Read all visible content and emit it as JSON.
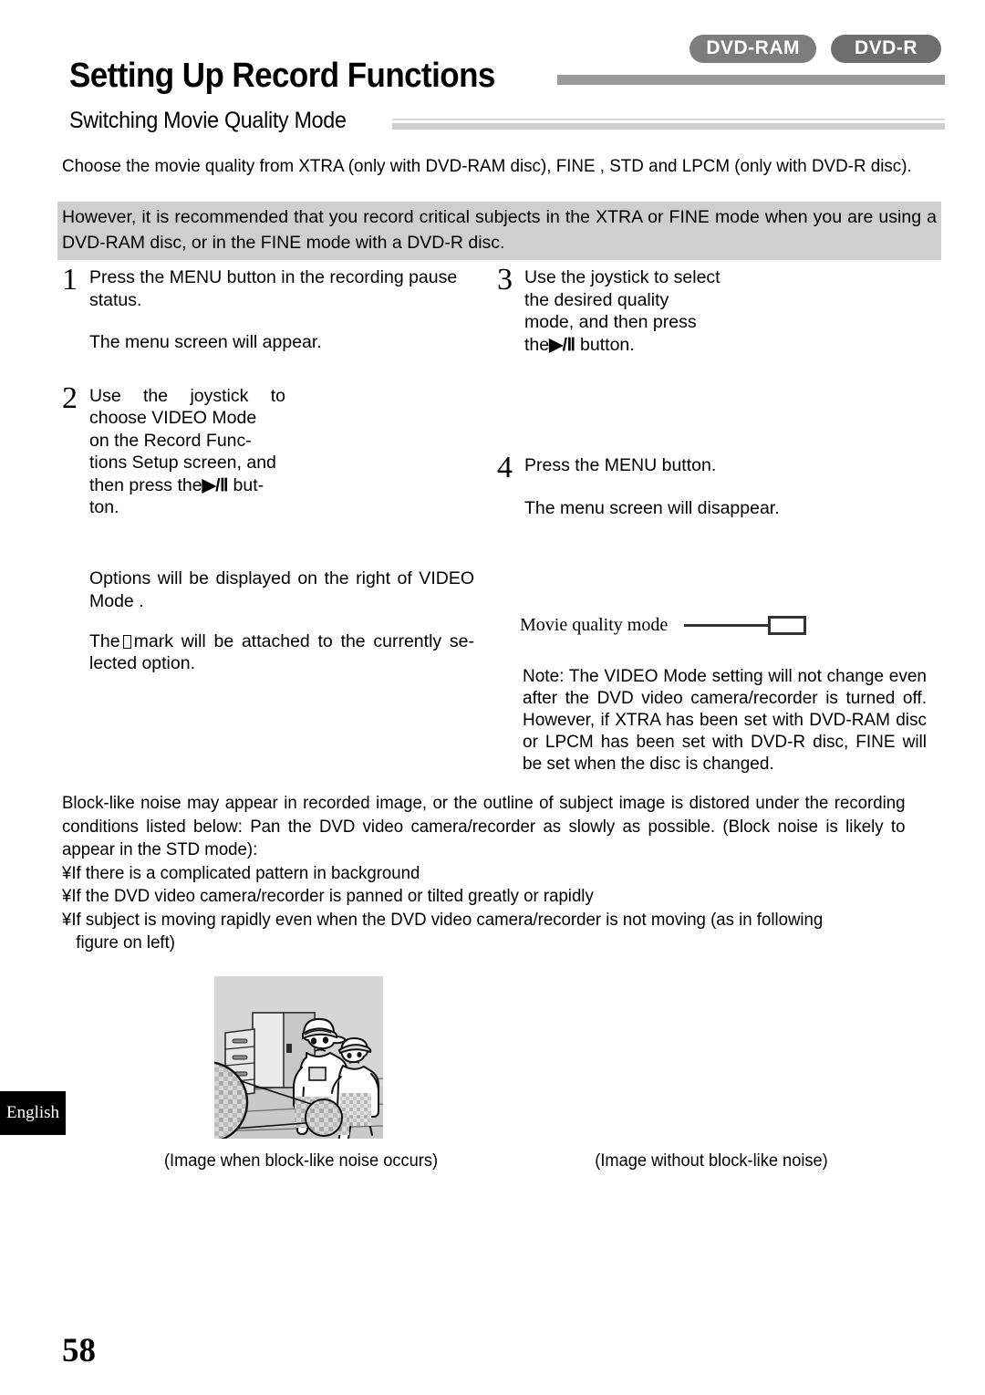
{
  "badges": [
    {
      "label": "DVD-RAM",
      "color": "#7d7d7d"
    },
    {
      "label": "DVD-R",
      "color": "#6e6e6e"
    }
  ],
  "headings": {
    "title": "Setting Up Record Functions",
    "subtitle": "Switching Movie Quality Mode"
  },
  "intro": {
    "paragraph": "Choose the movie quality from  XTRA  (only with DVD-RAM disc),   FINE , STD  and  LPCM  (only with DVD-R disc).",
    "highlight": "However, it is recommended that you record critical subjects in the  XTRA  or  FINE  mode when you are using a DVD-RAM disc, or in the  FINE  mode with a DVD-R disc."
  },
  "steps": {
    "step1": {
      "number": "1",
      "text": "Press the MENU button in the recording pause status.",
      "result": "The menu screen will appear."
    },
    "step2": {
      "number": "2",
      "text_a": "Use  the  joystick  to choose  VIDEO Mode",
      "text_b": "on the   Record  Func-",
      "text_c": "tions Setup  screen, and",
      "text_d": "then press the",
      "button_glyph": "▶/Ⅱ",
      "text_e": " but-",
      "text_f": "ton.",
      "note_a": "Options  will  be  displayed  on  the  right  of  VIDEO Mode  .",
      "note_b_pre": "The",
      "note_b_post": "mark will be attached to the currently se-lected option."
    },
    "step3": {
      "number": "3",
      "line1": "Use the joystick to select",
      "line2": "the   desired   quality",
      "line3": "mode,  and  then  press",
      "line4_pre": "the",
      "button_glyph": "▶/Ⅱ",
      "line4_post": " button."
    },
    "step4": {
      "number": "4",
      "text": "Press the MENU button.",
      "result": "The menu screen will disappear."
    }
  },
  "callout": {
    "label": "Movie quality mode"
  },
  "note": {
    "text": "Note:   The   VIDEO Mode    setting will not change even  after  the  DVD  video  camera/recorder  is turned off. However, if     XTRA  has  been  set  with DVD-RAM disc or   LPCM   has been set with DVD-R disc,  FINE  will be set when the disc is changed."
  },
  "block_noise": {
    "paragraph": "Block-like noise may appear in recorded image, or the outline of subject image is distored under the recording conditions listed below: Pan the DVD video camera/recorder as slowly as possible. (Block noise is likely to appear in the  STD  mode):",
    "bullets": [
      "¥If there is a complicated pattern in background",
      "¥If the DVD video camera/recorder is panned or tilted greatly or rapidly",
      "¥If subject is moving rapidly even when the DVD video camera/recorder is not moving (as in following"
    ],
    "bullet3_cont": "figure on left)"
  },
  "figures": {
    "caption_left": "(Image when block-like noise occurs)",
    "caption_right": "(Image without block-like noise)"
  },
  "language_tab": "English",
  "page_number": "58"
}
